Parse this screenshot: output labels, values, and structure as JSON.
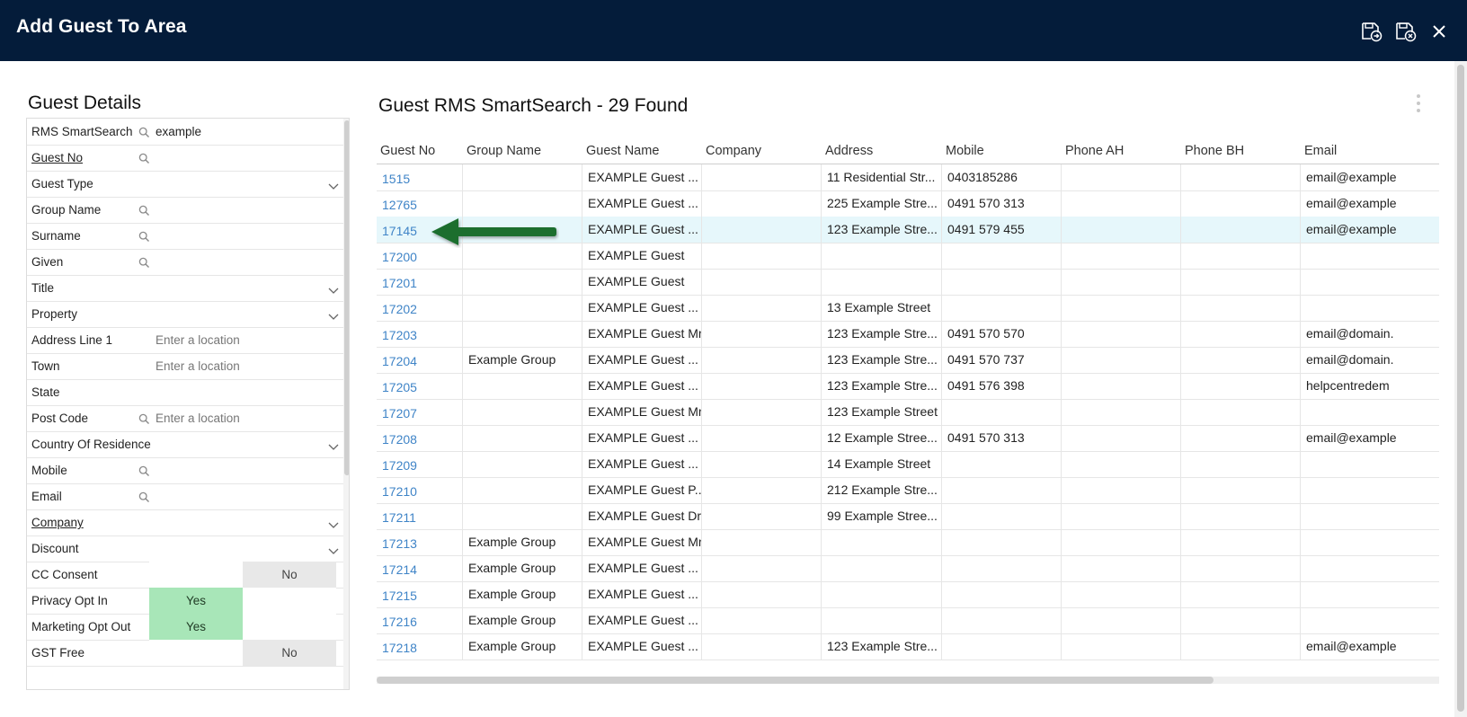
{
  "header": {
    "title": "Add Guest To Area",
    "buttons": [
      {
        "name": "save-and-add-button",
        "icon": "save-add-icon"
      },
      {
        "name": "save-and-exit-button",
        "icon": "save-exit-icon"
      },
      {
        "name": "close-button",
        "icon": "close-icon"
      }
    ],
    "background": "#041c3a"
  },
  "guest_details": {
    "title": "Guest Details",
    "fields": [
      {
        "label": "RMS SmartSearch",
        "search": true,
        "value": "example"
      },
      {
        "label": "Guest No",
        "search": true,
        "underline": true
      },
      {
        "label": "Guest Type",
        "dropdown": true
      },
      {
        "label": "Group Name",
        "search": true
      },
      {
        "label": "Surname",
        "search": true
      },
      {
        "label": "Given",
        "search": true
      },
      {
        "label": "Title",
        "dropdown": true
      },
      {
        "label": "Property",
        "dropdown": true
      },
      {
        "label": "Address Line 1",
        "placeholder": "Enter a location"
      },
      {
        "label": "Town",
        "placeholder": "Enter a location"
      },
      {
        "label": "State"
      },
      {
        "label": "Post Code",
        "search": true,
        "placeholder": "Enter a location"
      },
      {
        "label": "Country Of Residence",
        "dropdown": true
      },
      {
        "label": "Mobile",
        "search": true
      },
      {
        "label": "Email",
        "search": true
      },
      {
        "label": "Company",
        "dropdown": true,
        "underline": true
      },
      {
        "label": "Discount",
        "dropdown": true
      },
      {
        "label": "CC Consent",
        "toggle": "No"
      },
      {
        "label": "Privacy Opt In",
        "toggle": "Yes"
      },
      {
        "label": "Marketing Opt Out",
        "toggle": "Yes"
      },
      {
        "label": "GST Free",
        "toggle": "No"
      }
    ],
    "toggle_labels": {
      "yes": "Yes",
      "no": "No"
    }
  },
  "results": {
    "title": "Guest RMS SmartSearch - 29 Found",
    "columns": [
      "Guest No",
      "Group Name",
      "Guest Name",
      "Company",
      "Address",
      "Mobile",
      "Phone AH",
      "Phone BH",
      "Email"
    ],
    "selected_row": 2,
    "rows": [
      [
        "1515",
        "",
        "EXAMPLE Guest ...",
        "",
        "11 Residential Str...",
        "0403185286",
        "",
        "",
        "email@example"
      ],
      [
        "12765",
        "",
        "EXAMPLE Guest ...",
        "",
        "225 Example Stre...",
        "0491 570 313",
        "",
        "",
        "email@example"
      ],
      [
        "17145",
        "",
        "EXAMPLE Guest ...",
        "",
        "123 Example Stre...",
        "0491 579 455",
        "",
        "",
        "email@example"
      ],
      [
        "17200",
        "",
        "EXAMPLE Guest",
        "",
        "",
        "",
        "",
        "",
        ""
      ],
      [
        "17201",
        "",
        "EXAMPLE Guest",
        "",
        "",
        "",
        "",
        "",
        ""
      ],
      [
        "17202",
        "",
        "EXAMPLE Guest ...",
        "",
        "13 Example Street",
        "",
        "",
        "",
        ""
      ],
      [
        "17203",
        "",
        "EXAMPLE Guest Mr",
        "",
        "123 Example Stre...",
        "0491 570 570",
        "",
        "",
        "email@domain."
      ],
      [
        "17204",
        "Example Group",
        "EXAMPLE Guest ...",
        "",
        "123 Example Stre...",
        "0491 570 737",
        "",
        "",
        "email@domain."
      ],
      [
        "17205",
        "",
        "EXAMPLE Guest ...",
        "",
        "123 Example Stre...",
        "0491 576 398",
        "",
        "",
        "helpcentredem"
      ],
      [
        "17207",
        "",
        "EXAMPLE Guest Mr",
        "",
        "123 Example Street",
        "",
        "",
        "",
        ""
      ],
      [
        "17208",
        "",
        "EXAMPLE Guest ...",
        "",
        "12 Example Stree...",
        "0491 570 313",
        "",
        "",
        "email@example"
      ],
      [
        "17209",
        "",
        "EXAMPLE Guest ...",
        "",
        "14 Example Street",
        "",
        "",
        "",
        ""
      ],
      [
        "17210",
        "",
        "EXAMPLE Guest P...",
        "",
        "212 Example Stre...",
        "",
        "",
        "",
        ""
      ],
      [
        "17211",
        "",
        "EXAMPLE Guest Dr",
        "",
        "99 Example Stree...",
        "",
        "",
        "",
        ""
      ],
      [
        "17213",
        "Example Group",
        "EXAMPLE Guest Mr",
        "",
        "",
        "",
        "",
        "",
        ""
      ],
      [
        "17214",
        "Example Group",
        "EXAMPLE Guest ...",
        "",
        "",
        "",
        "",
        "",
        ""
      ],
      [
        "17215",
        "Example Group",
        "EXAMPLE Guest ...",
        "",
        "",
        "",
        "",
        "",
        ""
      ],
      [
        "17216",
        "Example Group",
        "EXAMPLE Guest ...",
        "",
        "",
        "",
        "",
        "",
        ""
      ],
      [
        "17218",
        "Example Group",
        "EXAMPLE Guest ...",
        "",
        "123 Example Stre...",
        "",
        "",
        "",
        "email@example"
      ]
    ]
  },
  "colors": {
    "link": "#3f84c7",
    "selected_row": "#e6f7fb",
    "toggle_yes": "#a8e6b8",
    "toggle_no": "#e8e8e8",
    "arrow": "#1e6e2e"
  }
}
